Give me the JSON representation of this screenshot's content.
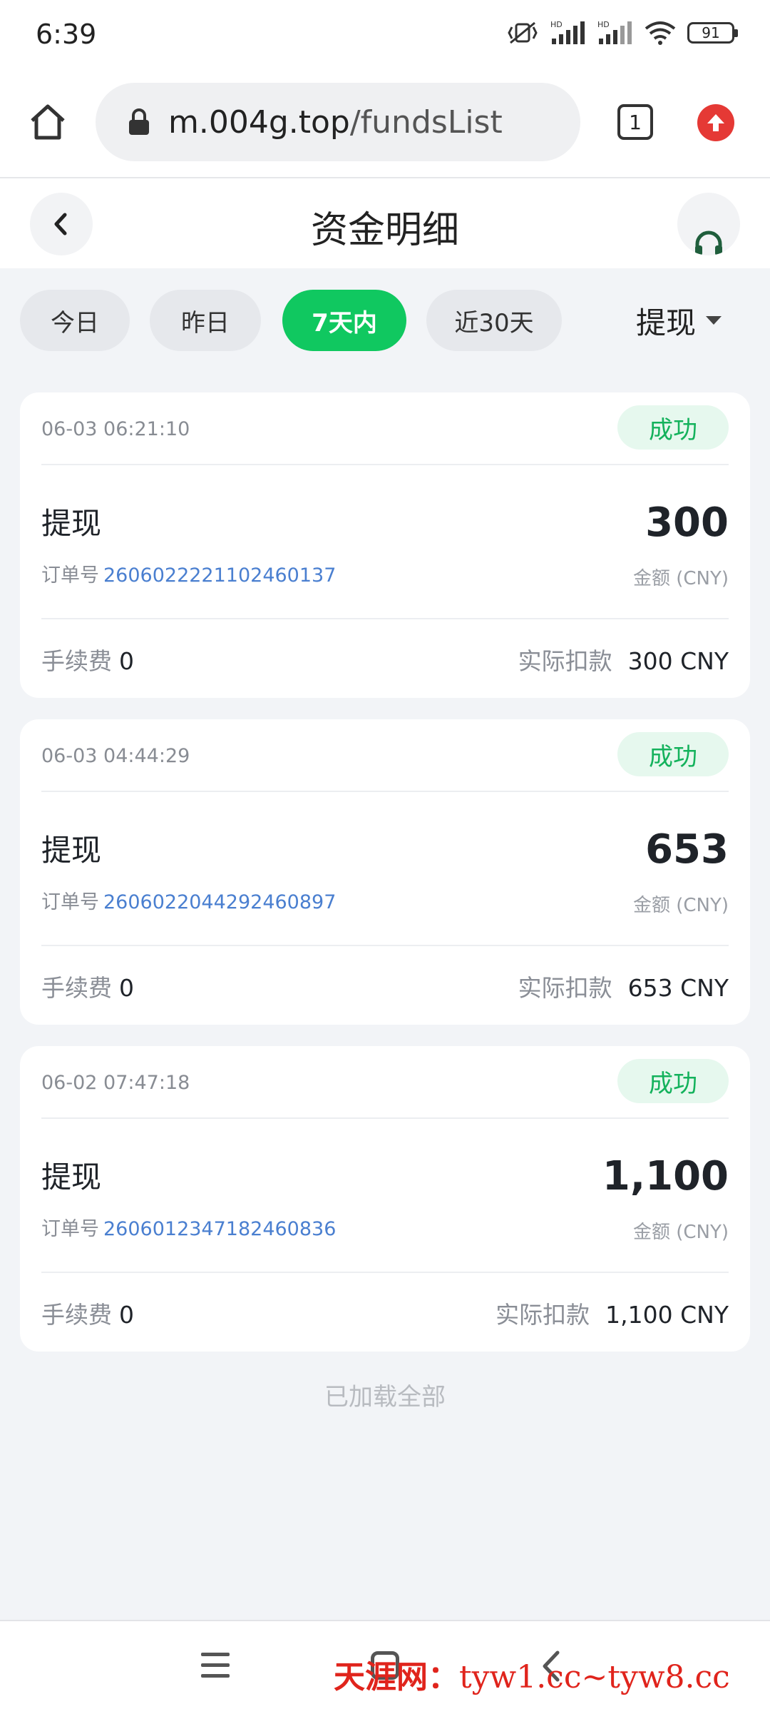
{
  "status_bar": {
    "time": "6:39",
    "battery": "91"
  },
  "browser": {
    "url_host": "m.004g.top",
    "url_path": "/fundsList",
    "tab_count": "1"
  },
  "header": {
    "title": "资金明细"
  },
  "filters": {
    "chips": [
      {
        "label": "今日",
        "active": false
      },
      {
        "label": "昨日",
        "active": false
      },
      {
        "label": "7天内",
        "active": true
      },
      {
        "label": "近30天",
        "active": false
      }
    ],
    "type_select": "提现"
  },
  "records": [
    {
      "time": "06-03 06:21:10",
      "status": "成功",
      "type": "提现",
      "order_label": "订单号",
      "order_no": "2606022221102460137",
      "amount": "300",
      "amount_label": "金额 (CNY)",
      "fee_label": "手续费",
      "fee": "0",
      "actual_label": "实际扣款",
      "actual": "300 CNY"
    },
    {
      "time": "06-03 04:44:29",
      "status": "成功",
      "type": "提现",
      "order_label": "订单号",
      "order_no": "2606022044292460897",
      "amount": "653",
      "amount_label": "金额 (CNY)",
      "fee_label": "手续费",
      "fee": "0",
      "actual_label": "实际扣款",
      "actual": "653 CNY"
    },
    {
      "time": "06-02 07:47:18",
      "status": "成功",
      "type": "提现",
      "order_label": "订单号",
      "order_no": "2606012347182460836",
      "amount": "1,100",
      "amount_label": "金额 (CNY)",
      "fee_label": "手续费",
      "fee": "0",
      "actual_label": "实际扣款",
      "actual": "1,100 CNY"
    }
  ],
  "footer_text": "已加载全部",
  "watermark": {
    "cn": "天涯网：",
    "en": "tyw1.cc~tyw8.cc"
  },
  "colors": {
    "accent_green": "#10c860",
    "success_text": "#14b25c",
    "order_link": "#4a7fd0",
    "update_red": "#e53935"
  }
}
